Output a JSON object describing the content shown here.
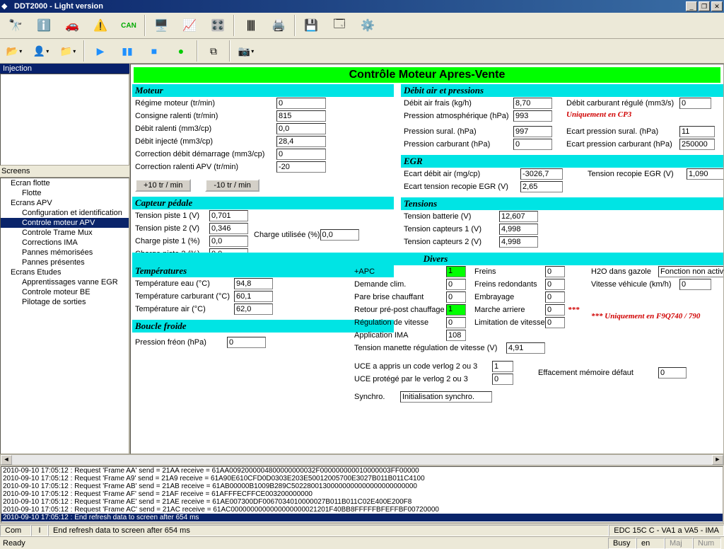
{
  "window": {
    "title": "DDT2000 - Light version"
  },
  "left": {
    "top_node": "Injection",
    "screens_label": "Screens",
    "tree": [
      {
        "label": "Ecran flotte",
        "children": [
          {
            "label": "Flotte"
          }
        ]
      },
      {
        "label": "Ecrans APV",
        "children": [
          {
            "label": "Configuration et identification"
          },
          {
            "label": "Controle moteur APV",
            "selected": true
          },
          {
            "label": "Controle Trame Mux"
          },
          {
            "label": "Corrections IMA"
          },
          {
            "label": "Pannes mémorisées"
          },
          {
            "label": "Pannes présentes"
          }
        ]
      },
      {
        "label": "Ecrans Etudes",
        "children": [
          {
            "label": "Apprentissages vanne EGR"
          },
          {
            "label": "Controle moteur BE"
          },
          {
            "label": "Pilotage de sorties"
          }
        ]
      }
    ]
  },
  "page": {
    "title": "Contrôle Moteur Apres-Vente"
  },
  "moteur": {
    "header": "Moteur",
    "regime_l": "Régime moteur (tr/min)",
    "regime_v": "0",
    "consigne_l": "Consigne ralenti (tr/min)",
    "consigne_v": "815",
    "debit_ral_l": "Débit ralenti (mm3/cp)",
    "debit_ral_v": "0,0",
    "debit_inj_l": "Débit injecté (mm3/cp)",
    "debit_inj_v": "28,4",
    "corr_dem_l": "Correction débit démarrage (mm3/cp)",
    "corr_dem_v": "0",
    "corr_ral_l": "Correction ralenti APV (tr/min)",
    "corr_ral_v": "-20",
    "btn_p": "+10 tr / min",
    "btn_m": "-10 tr / min"
  },
  "debit": {
    "header": "Débit air et pressions",
    "af_l": "Débit air frais (kg/h)",
    "af_v": "8,70",
    "pa_l": "Pression atmosphérique (hPa)",
    "pa_v": "993",
    "dcr_l": "Débit carburant régulé (mm3/s)",
    "dcr_v": "0",
    "note": "Uniquement en CP3",
    "ps_l": "Pression sural. (hPa)",
    "ps_v": "997",
    "pc_l": "Pression carburant (hPa)",
    "pc_v": "0",
    "eps_l": "Ecart pression sural. (hPa)",
    "eps_v": "11",
    "epc_l": "Ecart pression carburant (hPa)",
    "epc_v": "250000"
  },
  "egr": {
    "header": "EGR",
    "eda_l": "Ecart débit air (mg/cp)",
    "eda_v": "-3026,7",
    "etr_l": "Ecart tension recopie EGR (V)",
    "etr_v": "2,65",
    "tre_l": "Tension recopie EGR (V)",
    "tre_v": "1,090"
  },
  "capteur": {
    "header": "Capteur pédale",
    "tp1_l": "Tension piste 1 (V)",
    "tp1_v": "0,701",
    "tp2_l": "Tension piste 2 (V)",
    "tp2_v": "0,346",
    "cp1_l": "Charge piste 1 (%)",
    "cp1_v": "0,0",
    "cp2_l": "Charge piste 2 (%)",
    "cp2_v": "0,0",
    "cu_l": "Charge utilisée (%)",
    "cu_v": "0,0"
  },
  "tensions": {
    "header": "Tensions",
    "tb_l": "Tension batterie (V)",
    "tb_v": "12,607",
    "tc1_l": "Tension capteurs 1 (V)",
    "tc1_v": "4,998",
    "tc2_l": "Tension capteurs 2 (V)",
    "tc2_v": "4,998"
  },
  "temp": {
    "header": "Températures",
    "te_l": "Température eau (°C)",
    "te_v": "94,8",
    "tc_l": "Température carburant (°C)",
    "tc_v": "60,1",
    "ta_l": "Température air (°C)",
    "ta_v": "62,0"
  },
  "boucle": {
    "header": "Boucle froide",
    "pf_l": "Pression fréon (hPa)",
    "pf_v": "0"
  },
  "divers": {
    "header": "Divers",
    "apc_l": "+APC",
    "apc_v": "1",
    "dc_l": "Demande clim.",
    "dc_v": "0",
    "pbc_l": "Pare brise chauffant",
    "pbc_v": "0",
    "rpp_l": "Retour pré-post chauffage",
    "rpp_v": "1",
    "rv_l": "Régulation de vitesse",
    "rv_v": "0",
    "ai_l": "Application IMA",
    "ai_v": "108",
    "fr_l": "Freins",
    "fr_v": "0",
    "frr_l": "Freins redondants",
    "frr_v": "0",
    "emb_l": "Embrayage",
    "emb_v": "0",
    "ma_l": "Marche arriere",
    "ma_v": "0",
    "ma_star": "***",
    "lv_l": "Limitation de vitesse",
    "lv_v": "0",
    "h2o_l": "H2O dans gazole",
    "h2o_v": "Fonction non active",
    "vv_l": "Vitesse véhicule (km/h)",
    "vv_v": "0",
    "note2": "*** Uniquement en F9Q740 / 790",
    "tmrv_l": "Tension manette régulation de vitesse (V)",
    "tmrv_v": "4,91",
    "uce1_l": "UCE a appris un code verlog 2 ou 3",
    "uce1_v": "1",
    "uce2_l": "UCE protégé par le verlog 2 ou 3",
    "uce2_v": "0",
    "emd_l": "Effacement mémoire défaut",
    "emd_v": "0",
    "syn_l": "Synchro.",
    "syn_v": "Initialisation synchro."
  },
  "log": {
    "lines": [
      "2010-09-10 17:05:12 : Request 'Frame AA' send = 21AA receive = 61AA0092000004800000000032F000000000010000003FF00000",
      "2010-09-10 17:05:12 : Request 'Frame A9' send = 21A9 receive = 61A90E610CFD0D0303E203E50012005700E3027B011B011C4100",
      "2010-09-10 17:05:12 : Request 'Frame AB' send = 21AB receive = 61AB00000B1009B289C50228001300000000000000000000000",
      "2010-09-10 17:05:12 : Request 'Frame AF' send = 21AF receive = 61AFFFECFFCE003200000000",
      "2010-09-10 17:05:12 : Request 'Frame AE' send = 21AE receive = 61AE007300DF0067034010000027B011B011C02E400E200F8",
      "2010-09-10 17:05:12 : Request 'Frame AC' send = 21AC receive = 61AC0000000000000000000021201F40BB8FFFFFBFEFFBF00720000",
      "2010-09-10 17:05:12 : End refresh data to screen after 654 ms"
    ],
    "sel_idx": 6
  },
  "status": {
    "com": "Com",
    "i": "I",
    "msg": "End refresh data to screen after 654 ms",
    "ecu": "EDC 15C C - VA1 a VA5 - IMA",
    "ready": "Ready",
    "busy": "Busy",
    "en": "en",
    "maj": "Maj",
    "num": "Num"
  }
}
